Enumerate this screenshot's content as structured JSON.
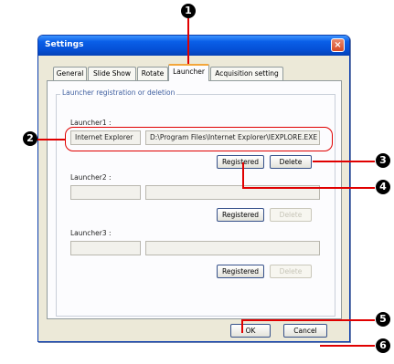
{
  "window": {
    "title": "Settings",
    "close_glyph": "×"
  },
  "tabs": [
    {
      "label": "General"
    },
    {
      "label": "Slide Show"
    },
    {
      "label": "Rotate"
    },
    {
      "label": "Launcher"
    },
    {
      "label": "Acquisition setting"
    }
  ],
  "group_title": "Launcher registration or deletion",
  "launchers": [
    {
      "label": "Launcher1 :",
      "name": "Internet Explorer",
      "path": "D:\\Program Files\\Internet Explorer\\IEXPLORE.EXE",
      "register_label": "Registered",
      "delete_label": "Delete",
      "delete_enabled": true
    },
    {
      "label": "Launcher2 :",
      "name": "",
      "path": "",
      "register_label": "Registered",
      "delete_label": "Delete",
      "delete_enabled": false
    },
    {
      "label": "Launcher3 :",
      "name": "",
      "path": "",
      "register_label": "Registered",
      "delete_label": "Delete",
      "delete_enabled": false
    }
  ],
  "footer": {
    "ok_label": "OK",
    "cancel_label": "Cancel"
  },
  "callouts": [
    "1",
    "2",
    "3",
    "4",
    "5",
    "6"
  ],
  "colors": {
    "callout_line": "#e00000",
    "title_bar": "#0550d6",
    "active_tab_accent": "#f3a63b"
  }
}
